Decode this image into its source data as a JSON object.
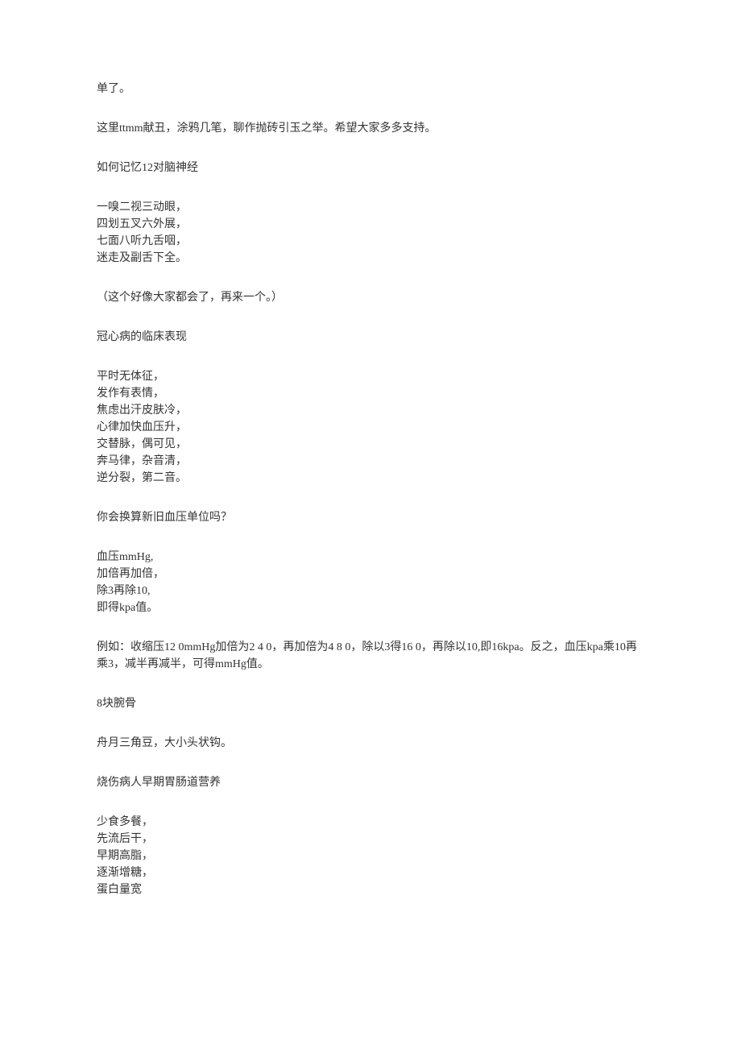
{
  "paragraphs": [
    {
      "lines": [
        "单了。"
      ]
    },
    {
      "lines": [
        "这里ttmm献丑，涂鸦几笔，聊作抛砖引玉之举。希望大家多多支持。"
      ]
    },
    {
      "lines": [
        "如何记忆12对脑神经"
      ]
    },
    {
      "lines": [
        "一嗅二视三动眼，",
        "四划五叉六外展，",
        "七面八听九舌咽，",
        "迷走及副舌下全。"
      ]
    },
    {
      "lines": [
        "（这个好像大家都会了，再来一个。）"
      ]
    },
    {
      "lines": [
        "冠心病的临床表现"
      ]
    },
    {
      "lines": [
        "平时无体征，",
        "发作有表情，",
        "焦虑出汗皮肤冷，",
        "心律加快血压升，",
        "交替脉，偶可见，",
        "奔马律，杂音清，",
        "逆分裂，第二音。"
      ]
    },
    {
      "lines": [
        "你会换算新旧血压单位吗？"
      ]
    },
    {
      "lines": [
        "血压mmHg,",
        "加倍再加倍，",
        "除3再除10,",
        "即得kpa值。"
      ]
    },
    {
      "lines": [
        "例如：收缩压12 0mmHg加倍为2 4 0，再加倍为4 8 0，除以3得16 0，再除以10,即16kpa。反之，血压kpa乘10再乘3，减半再减半，可得mmHg值。"
      ]
    },
    {
      "lines": [
        "8块腕骨"
      ]
    },
    {
      "lines": [
        "舟月三角豆，大小头状钩。"
      ]
    },
    {
      "lines": [
        "烧伤病人早期胃肠道营养"
      ]
    },
    {
      "lines": [
        "少食多餐，",
        "先流后干，",
        "早期高脂，",
        "逐渐增糖，",
        "蛋白量宽"
      ]
    }
  ]
}
